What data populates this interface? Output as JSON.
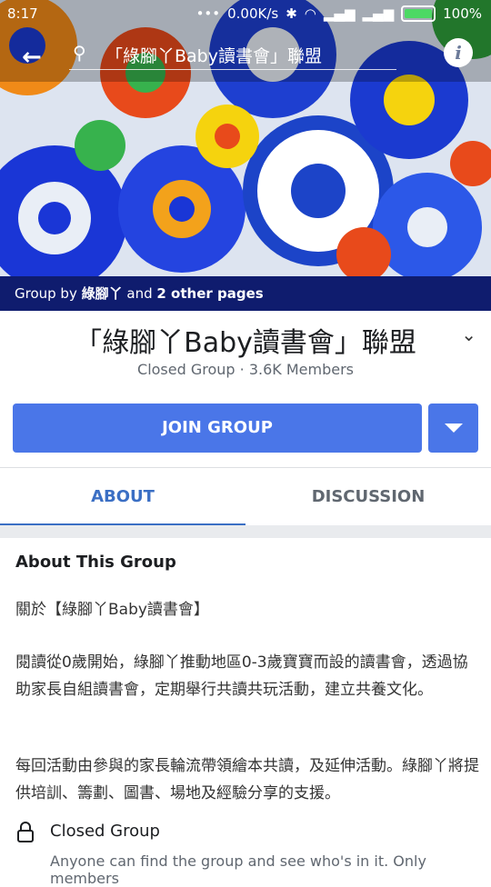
{
  "status_bar": {
    "time": "8:17",
    "network_speed": "0.00K/s",
    "battery": "100%"
  },
  "search": {
    "query": "「綠腳丫Baby讀書會」聯盟"
  },
  "cover": {
    "group_by_prefix": "Group by ",
    "group_by_name": "綠腳丫",
    "group_by_and": " and ",
    "group_by_others": "2 other pages"
  },
  "group": {
    "title": "「綠腳丫Baby讀書會」聯盟",
    "meta": "Closed Group · 3.6K Members",
    "join_label": "JOIN GROUP"
  },
  "tabs": [
    {
      "label": "ABOUT",
      "active": true
    },
    {
      "label": "DISCUSSION",
      "active": false
    }
  ],
  "about": {
    "heading": "About This Group",
    "para1": "關於【綠腳丫Baby讀書會】",
    "para2": "閱讀從0歲開始，綠腳丫推動地區0-3歲寶寶而設的讀書會，透過協助家長自組讀書會，定期舉行共讀共玩活動，建立共養文化。",
    "para3": "每回活動由參與的家長輪流帶領繪本共讀，及延伸活動。綠腳丫將提供培訓、籌劃、圖書、場地及經驗分享的支援。",
    "privacy_title": "Closed Group",
    "privacy_desc": "Anyone can find the group and see who's in it. Only members"
  },
  "colors": {
    "accent": "#4a76e8",
    "tab_active": "#3b6fc4",
    "banner": "#0f1c6e"
  }
}
